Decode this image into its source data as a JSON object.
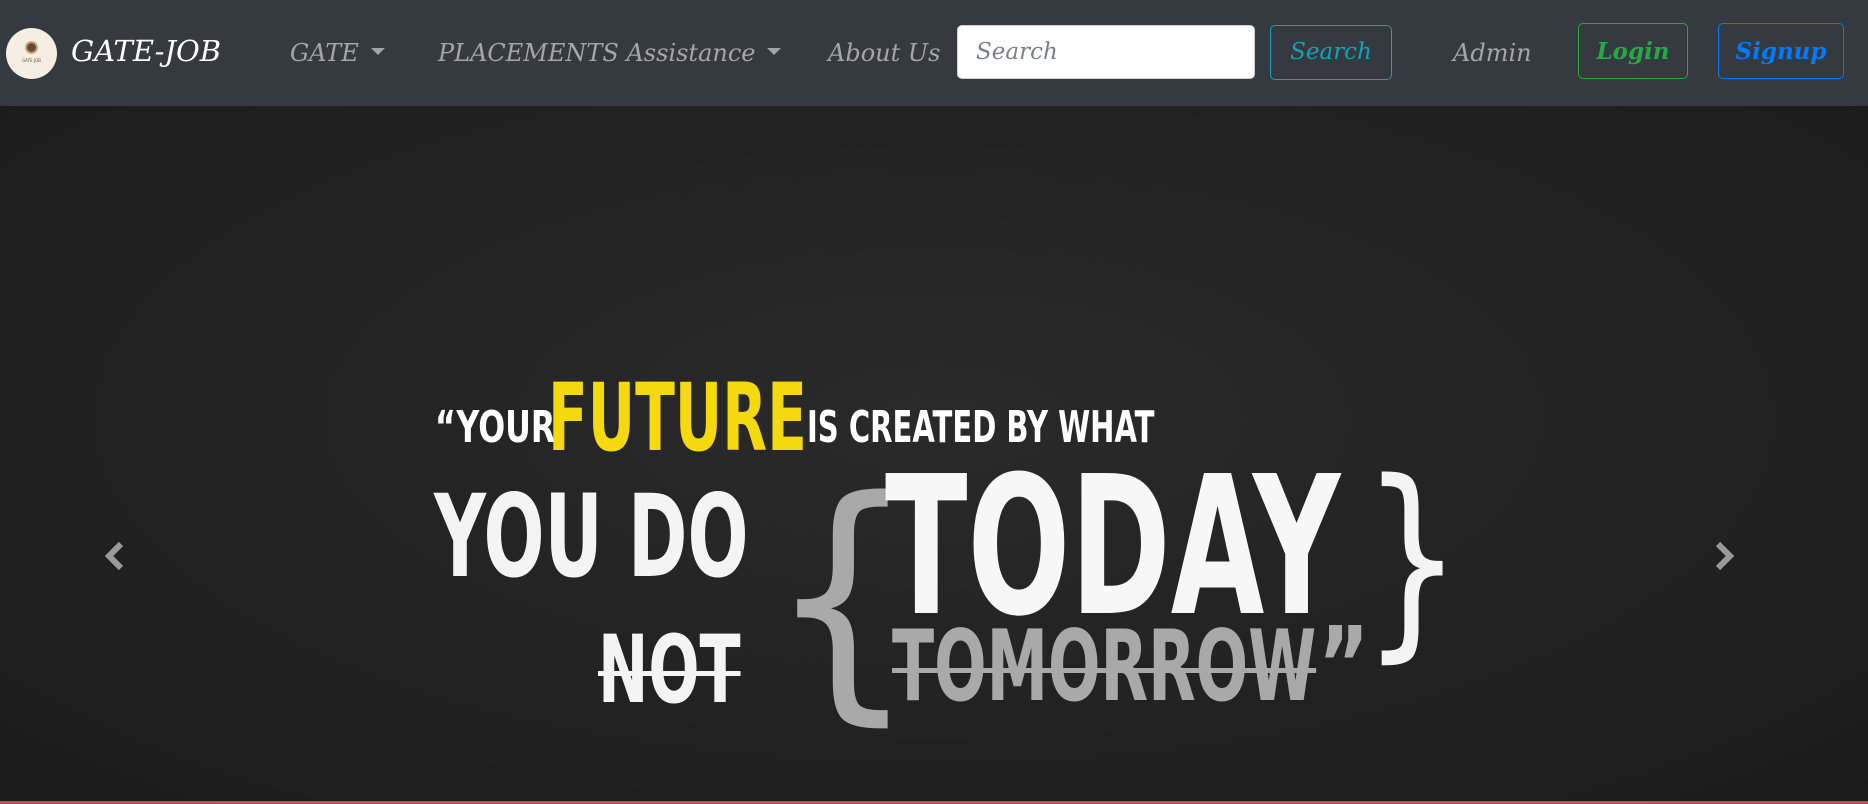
{
  "brand": {
    "name": "GATE-JOB",
    "logo_text": "GATE JOB"
  },
  "nav": {
    "items": [
      {
        "label": "GATE",
        "dropdown": true
      },
      {
        "label": "PLACEMENTS Assistance",
        "dropdown": true
      },
      {
        "label": "About Us",
        "dropdown": false
      }
    ],
    "admin_label": "Admin"
  },
  "search": {
    "placeholder": "Search",
    "value": "",
    "button_label": "Search"
  },
  "auth": {
    "login_label": "Login",
    "signup_label": "Signup"
  },
  "carousel": {
    "slide": {
      "line1_open": "“YOUR",
      "line1_highlight": "FUTURE",
      "line1_rest": "IS CREATED BY WHAT",
      "line2_left": "YOU DO",
      "brace_open": "{",
      "line2_main": "TODAY",
      "brace_close": "}",
      "line3_left": "NOT",
      "line3_main": "TOMORROW",
      "quote_close": "”"
    },
    "prev_icon": "chevron-left-icon",
    "next_icon": "chevron-right-icon"
  },
  "colors": {
    "navbar_bg": "#343a40",
    "highlight": "#f5d90f",
    "search_btn": "#17a2b8",
    "login_btn": "#28a745",
    "signup_btn": "#007bff"
  }
}
